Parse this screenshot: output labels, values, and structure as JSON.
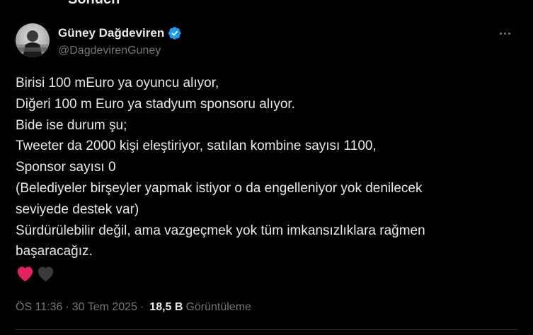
{
  "top_cut_text": "Sonuch",
  "author": {
    "name": "Güney Dağdeviren",
    "handle": "@DagdevirenGuney",
    "verified": true
  },
  "tweet": {
    "lines": [
      "Birisi 100 mEuro ya oyuncu alıyor,",
      "Diğeri 100 m Euro ya stadyum sponsoru alıyor.",
      "Bide ise durum şu;",
      "Tweeter da 2000 kişi eleştiriyor, satılan kombine sayısı 1100,",
      "Sponsor sayısı 0",
      "(Belediyeler birşeyler yapmak istiyor o da engelleniyor yok denilecek",
      "seviyede destek var)",
      "Sürdürülebilir değil, ama vazgeçmek yok tüm imkansızlıklara rağmen",
      "başaracağız."
    ],
    "emojis": [
      "red-heart",
      "black-heart"
    ]
  },
  "meta": {
    "time": "ÖS 11:36",
    "separator": "·",
    "date": "30 Tem 2025",
    "views_count": "18,5 B",
    "views_label": "Görüntüleme"
  },
  "colors": {
    "background": "#000000",
    "text": "#e7e9ea",
    "secondary": "#71767b",
    "verified": "#1d9bf0",
    "red_heart": "#e0245e",
    "black_heart": "#3a3a3a"
  }
}
